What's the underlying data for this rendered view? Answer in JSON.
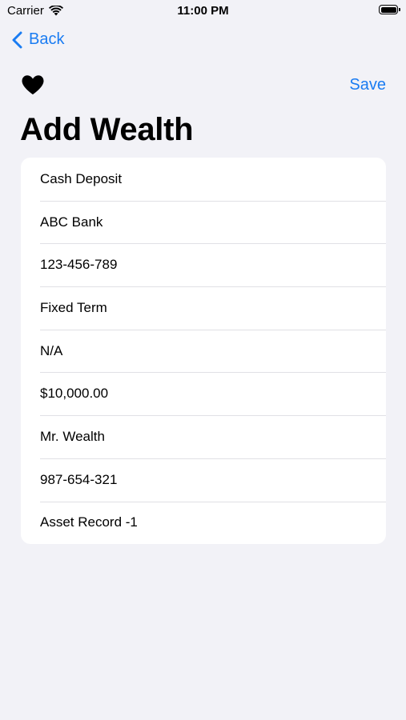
{
  "status_bar": {
    "carrier": "Carrier",
    "time": "11:00 PM"
  },
  "nav": {
    "back_label": "Back",
    "save_label": "Save"
  },
  "page_title": "Add Wealth",
  "fields": [
    {
      "value": "Cash Deposit"
    },
    {
      "value": "ABC Bank"
    },
    {
      "value": "123-456-789"
    },
    {
      "value": "Fixed Term"
    },
    {
      "value": "N/A"
    },
    {
      "value": "$10,000.00"
    },
    {
      "value": "Mr. Wealth"
    },
    {
      "value": "987-654-321"
    },
    {
      "value": "Asset Record -1"
    }
  ],
  "colors": {
    "accent": "#1a7cf2",
    "background": "#f2f2f7",
    "card": "#ffffff",
    "separator": "#e0e0e5"
  },
  "icons": [
    "wifi-icon",
    "battery-icon",
    "chevron-left-icon",
    "heart-icon"
  ]
}
